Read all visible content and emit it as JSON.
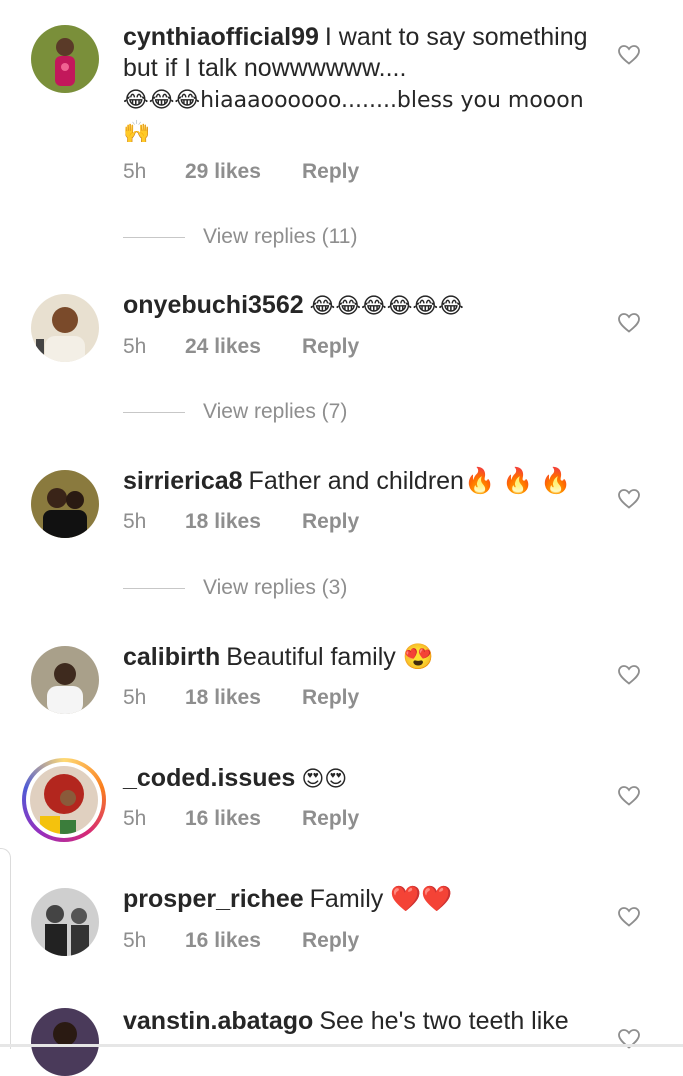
{
  "comments": [
    {
      "username": "cynthiaofficial99",
      "text": "I want to say something but if I talk nowwwwww....",
      "text2": "😂😂😂hiaaaoooooo........bless you mooon🙌",
      "time": "5h",
      "likes": "29 likes",
      "reply": "Reply",
      "view_replies": "View replies (11)",
      "avatar_color": "#7a8f3a"
    },
    {
      "username": "onyebuchi3562",
      "text": "😂😂😂😂😂😂",
      "time": "5h",
      "likes": "24 likes",
      "reply": "Reply",
      "view_replies": "View replies (7)",
      "avatar_color": "#c9b38a"
    },
    {
      "username": "sirrierica8",
      "text": "Father and children🔥 🔥 🔥",
      "time": "5h",
      "likes": "18 likes",
      "reply": "Reply",
      "view_replies": "View replies (3)",
      "avatar_color": "#6b5a2e"
    },
    {
      "username": "calibirth",
      "text": "Beautiful family 😍",
      "time": "5h",
      "likes": "18 likes",
      "reply": "Reply",
      "avatar_color": "#9a8a6a"
    },
    {
      "username": "_coded.issues",
      "text": "😍😍",
      "time": "5h",
      "likes": "16 likes",
      "reply": "Reply",
      "avatar_color": "#b3261e"
    },
    {
      "username": "prosper_richee",
      "text": "Family ❤️❤️",
      "time": "5h",
      "likes": "16 likes",
      "reply": "Reply",
      "avatar_color": "#5a5a5a"
    },
    {
      "username": "vanstin.abatago",
      "text": "See he's two teeth like",
      "avatar_color": "#4a3a5a"
    }
  ],
  "colors": {
    "text": "#262626",
    "meta": "#8e8e8e",
    "heart_stroke": "#8e8e8e"
  },
  "icons": {
    "like": "heart-outline-icon"
  }
}
